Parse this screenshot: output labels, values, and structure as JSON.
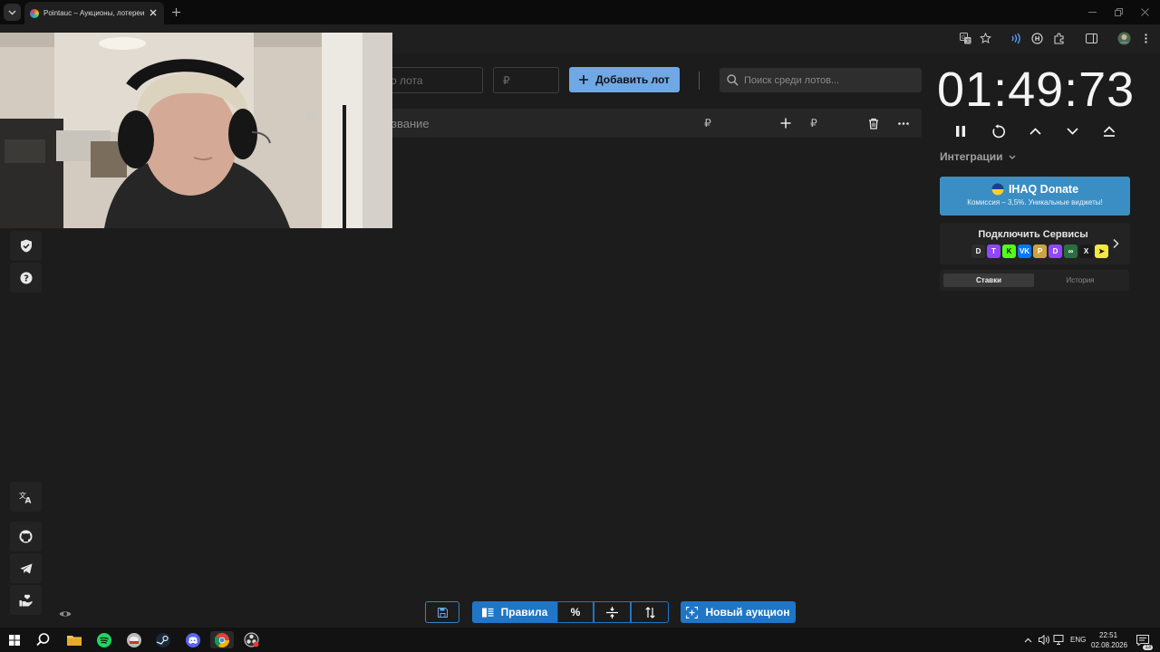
{
  "browser": {
    "tab_title": "Pointauc – Аукционы, лотереи",
    "icons": [
      "tab-search-icon",
      "close-icon",
      "new-tab-icon",
      "translate-icon",
      "bookmark-star-icon",
      "extension-icons",
      "profile-avatar",
      "kebab-menu-icon"
    ]
  },
  "lots_panel": {
    "name_placeholder": "о лота",
    "amount_placeholder": "₽",
    "add_button": "Добавить лот",
    "search_placeholder": "Поиск среди лотов...",
    "row": {
      "name": "звание",
      "currency": "₽",
      "plus": "+",
      "currency2": "₽"
    }
  },
  "timer": {
    "value": "01:49:73"
  },
  "integrations": {
    "label": "Интеграции",
    "donate_title": "IHAQ Donate",
    "donate_subtitle": "Комиссия – 3,5%. Уникальные виджеты!",
    "connect_title": "Подключить Сервисы",
    "services": [
      {
        "label": "D",
        "color": "#2d2d2d"
      },
      {
        "label": "T",
        "color": "#9146ff"
      },
      {
        "label": "K",
        "color": "#53fc18"
      },
      {
        "label": "VK",
        "color": "#0077ff"
      },
      {
        "label": "P",
        "color": "#c9a43f"
      },
      {
        "label": "D",
        "color": "#9147ff"
      },
      {
        "label": "∞",
        "color": "#2a6e3f"
      },
      {
        "label": "X",
        "color": "#1a1a1a"
      },
      {
        "label": "➤",
        "color": "#f5e642"
      }
    ]
  },
  "history_tabs": {
    "bets": "Ставки",
    "history": "История"
  },
  "bottom_bar": {
    "rules": "Правила",
    "percent": "%",
    "new_auction": "Новый аукцион"
  },
  "taskbar": {
    "language": "ENG",
    "time": "22:51",
    "date": "02.08.2026",
    "notifications": "13"
  },
  "colors": {
    "accent_blue": "#70a8e6",
    "donate_blue": "#3b8ec4",
    "action_blue": "#1f76c6",
    "background": "#1c1c1c"
  }
}
